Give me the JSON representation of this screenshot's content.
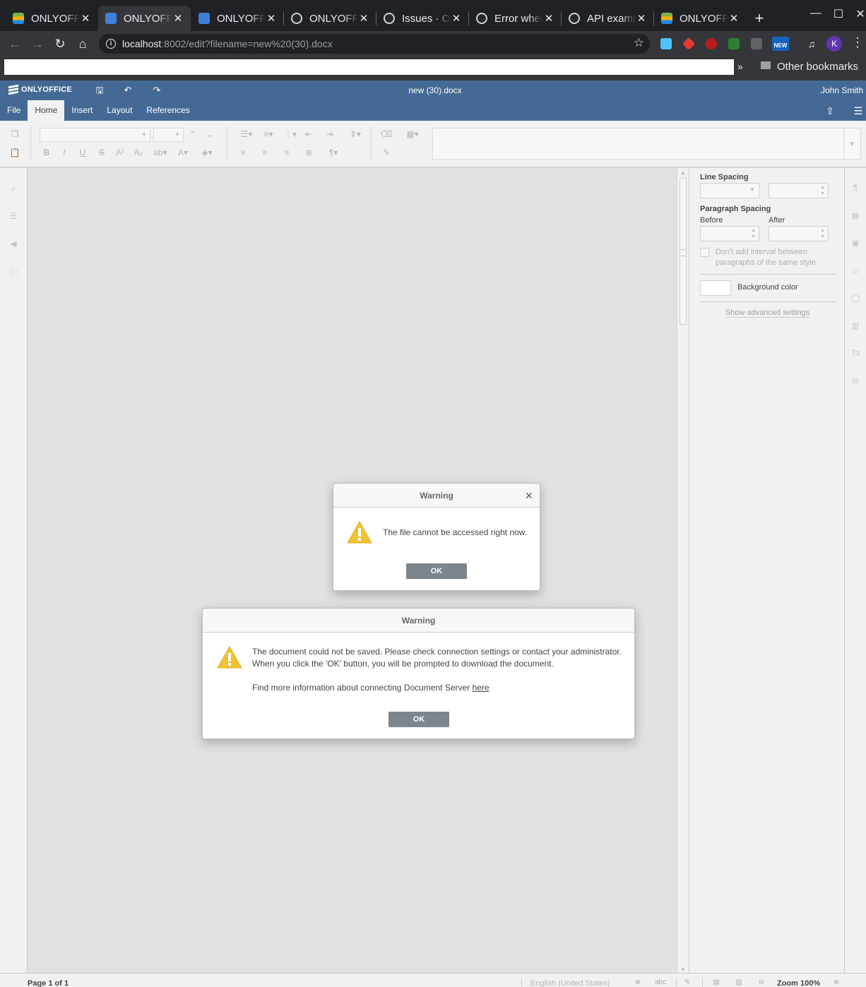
{
  "browser": {
    "tabs": [
      {
        "title": "ONLYOFFICE",
        "icon": "onlyoffice-favicon",
        "active": false
      },
      {
        "title": "ONLYOFFICE",
        "icon": "document-favicon",
        "active": true
      },
      {
        "title": "ONLYOFFICE",
        "icon": "document-favicon",
        "active": false
      },
      {
        "title": "ONLYOFFICE",
        "icon": "github-favicon",
        "active": false
      },
      {
        "title": "Issues · ONLYOFFICE",
        "icon": "github-favicon",
        "active": false
      },
      {
        "title": "Error when saving",
        "icon": "github-favicon",
        "active": false
      },
      {
        "title": "API examples",
        "icon": "github-favicon",
        "active": false
      },
      {
        "title": "ONLYOFFICE",
        "icon": "onlyoffice-favicon",
        "active": false
      }
    ],
    "url_host": "localhost",
    "url_rest": ":8002/edit?filename=new%20(30).docx",
    "profile_initial": "K",
    "bookmarks_other": "Other bookmarks",
    "bookmarks_more": "»",
    "ext_new_badge": "NEW"
  },
  "editor": {
    "logo": "ONLYOFFICE",
    "doc_title": "new (30).docx",
    "user": "John Smith",
    "menu": [
      "File",
      "Home",
      "Insert",
      "Layout",
      "References"
    ],
    "active_menu": "Home"
  },
  "right_panel": {
    "line_spacing": "Line Spacing",
    "paragraph_spacing": "Paragraph Spacing",
    "before": "Before",
    "after": "After",
    "dont_add_interval": "Don't add interval between paragraphs of the same style",
    "background_color": "Background color",
    "show_advanced": "Show advanced settings"
  },
  "statusbar": {
    "page": "Page 1 of 1",
    "language": "English (United States)",
    "zoom": "Zoom 100%"
  },
  "dialog1": {
    "title": "Warning",
    "message": "The file cannot be accessed right now.",
    "ok": "OK",
    "close": "×"
  },
  "dialog2": {
    "title": "Warning",
    "line1": "The document could not be saved. Please check connection settings or contact your administrator.",
    "line2": "When you click the 'OK' button, you will be prompted to download the document.",
    "more_info": "Find more information about connecting Document Server ",
    "link": "here",
    "ok": "OK"
  },
  "colors": {
    "tabstrip": "#202124",
    "browser_toolbar": "#35363a",
    "editor_header": "#446995",
    "panel_bg": "#f1f1f1",
    "canvas_bg": "#e1e1e1",
    "dialog_button": "#7d858c",
    "warning_yellow": "#f1c232"
  }
}
